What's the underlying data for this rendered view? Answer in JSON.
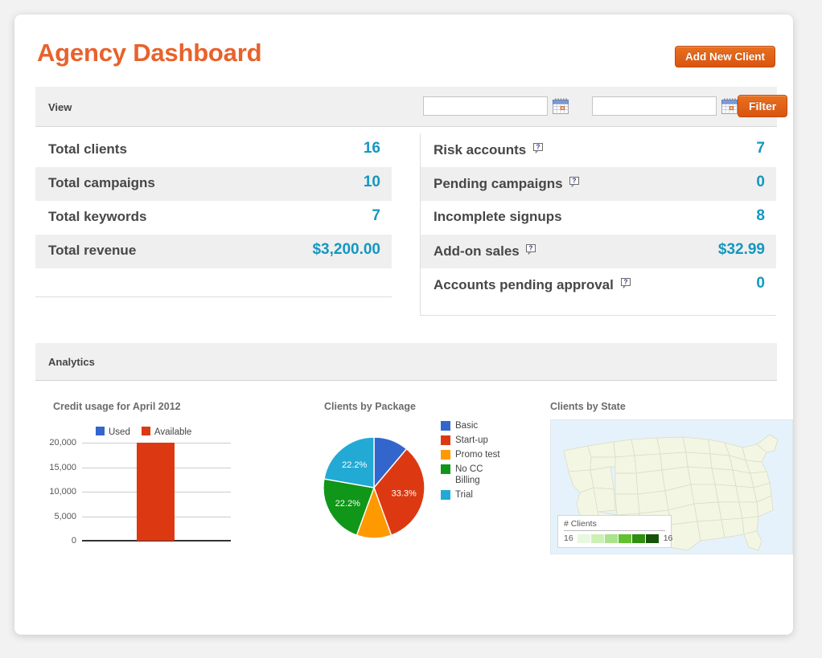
{
  "header": {
    "title": "Agency Dashboard",
    "add_client_label": "Add New Client",
    "title_color": "#e8622c",
    "button_color": "#de5b17"
  },
  "view_bar": {
    "label": "View",
    "date_from": "",
    "date_to": "",
    "date_from_placeholder": "",
    "date_to_placeholder": "",
    "calendar_icon": "calendar-icon",
    "filter_label": "Filter"
  },
  "stats": {
    "left": [
      {
        "label": "Total clients",
        "value": "16",
        "help": false
      },
      {
        "label": "Total campaigns",
        "value": "10",
        "help": false
      },
      {
        "label": "Total keywords",
        "value": "7",
        "help": false
      },
      {
        "label": "Total revenue",
        "value": "$3,200.00",
        "help": false
      }
    ],
    "right": [
      {
        "label": "Risk accounts",
        "value": "7",
        "help": true
      },
      {
        "label": "Pending campaigns",
        "value": "0",
        "help": true
      },
      {
        "label": "Incomplete signups",
        "value": "8",
        "help": false
      },
      {
        "label": "Add-on sales",
        "value": "$32.99",
        "help": true
      },
      {
        "label": "Accounts pending approval",
        "value": "0",
        "help": true
      }
    ],
    "value_color": "#1497c0",
    "help_icon": "help-question-icon"
  },
  "analytics": {
    "title": "Analytics"
  },
  "chart_data": [
    {
      "type": "bar",
      "title": "Credit usage for April 2012",
      "categories": [
        ""
      ],
      "series": [
        {
          "name": "Used",
          "values": [
            0
          ],
          "color": "#3366cc"
        },
        {
          "name": "Available",
          "values": [
            20000
          ],
          "color": "#dc3912"
        }
      ],
      "xlabel": "",
      "ylabel": "",
      "ylim": [
        0,
        20000
      ],
      "yticks": [
        "0",
        "5,000",
        "10,000",
        "15,000",
        "20,000"
      ],
      "grid": true,
      "legend_position": "top"
    },
    {
      "type": "pie",
      "title": "Clients by Package",
      "labels": [
        "Basic",
        "Start-up",
        "Promo test",
        "No CC Billing",
        "Trial"
      ],
      "values": [
        11.1,
        33.3,
        11.1,
        22.2,
        22.2
      ],
      "slice_labels": [
        "",
        "33.3%",
        "",
        "22.2%",
        "22.2%"
      ],
      "colors": [
        "#3366cc",
        "#dc3912",
        "#ff9900",
        "#109618",
        "#22aad4"
      ],
      "legend_position": "right"
    },
    {
      "type": "heatmap",
      "title": "Clients by State",
      "region": "United States",
      "legend_title": "# Clients",
      "legend_min": "16",
      "legend_max": "16",
      "legend_colors": [
        "#e8f8e0",
        "#cdf0b4",
        "#a9e38a",
        "#63c02f",
        "#2f8f10",
        "#17520a"
      ],
      "ocean_color": "#e5f2fb",
      "state_color": "#f4f6e4"
    }
  ]
}
